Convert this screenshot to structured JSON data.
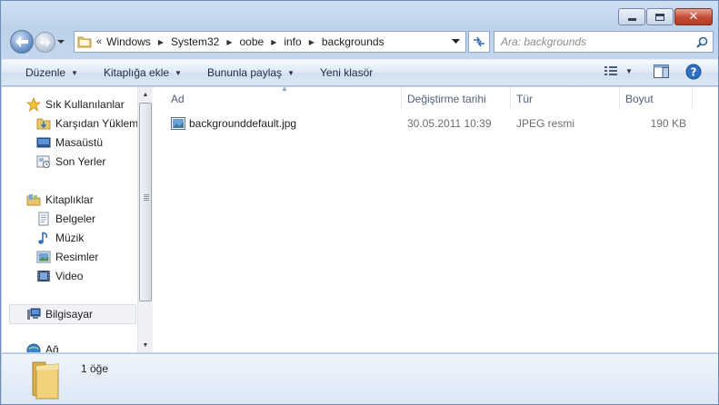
{
  "window": {
    "caption_buttons": [
      "minimize",
      "maximize",
      "close"
    ]
  },
  "address_bar": {
    "overflow_glyph": "«",
    "crumbs": [
      "Windows",
      "System32",
      "oobe",
      "info",
      "backgrounds"
    ]
  },
  "search": {
    "placeholder": "Ara: backgrounds"
  },
  "toolbar": {
    "organize": "Düzenle",
    "include_in_library": "Kitaplığa ekle",
    "share_with": "Bununla paylaş",
    "new_folder": "Yeni klasör"
  },
  "navigation": {
    "favorites": {
      "label": "Sık Kullanılanlar",
      "items": [
        "Karşıdan Yüklem",
        "Masaüstü",
        "Son Yerler"
      ]
    },
    "libraries": {
      "label": "Kitaplıklar",
      "items": [
        "Belgeler",
        "Müzik",
        "Resimler",
        "Video"
      ]
    },
    "computer": "Bilgisayar",
    "network": "Ağ"
  },
  "columns": {
    "name": "Ad",
    "date_modified": "Değiştirme tarihi",
    "type": "Tür",
    "size": "Boyut"
  },
  "files": [
    {
      "name": "backgrounddefault.jpg",
      "date_modified": "30.05.2011 10:39",
      "type": "JPEG resmi",
      "size": "190 KB"
    }
  ],
  "details": {
    "item_count": "1 öğe"
  },
  "colors": {
    "frame": "#c4d6ed",
    "close_button": "#c44a33",
    "toolbar_text": "#1e2c45",
    "column_header_text": "#4c607a",
    "search_placeholder": "#8a8a8a"
  }
}
